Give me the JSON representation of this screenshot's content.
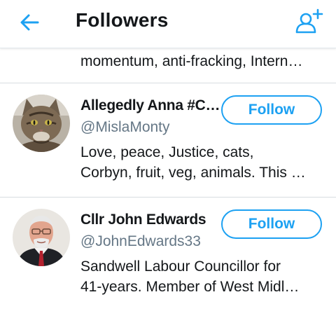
{
  "header": {
    "title": "Followers",
    "back_icon": "arrow-left-icon",
    "add_icon": "add-user-icon",
    "accent": "#1da1f2"
  },
  "followers": [
    {
      "bio": "momentum, anti-fracking, Intern…"
    },
    {
      "name": "Allegedly Anna #C…",
      "handle": "@MislaMonty",
      "bio_lines": [
        "Love, peace, Justice, cats,",
        "Corbyn, fruit, veg, animals. This …"
      ],
      "follow_label": "Follow",
      "avatar": "cat-avatar"
    },
    {
      "name": "Cllr John Edwards",
      "handle": "@JohnEdwards33",
      "bio_lines": [
        "Sandwell Labour Councillor for",
        "41-years. Member of West Midl…"
      ],
      "follow_label": "Follow",
      "avatar": "man-avatar"
    }
  ]
}
